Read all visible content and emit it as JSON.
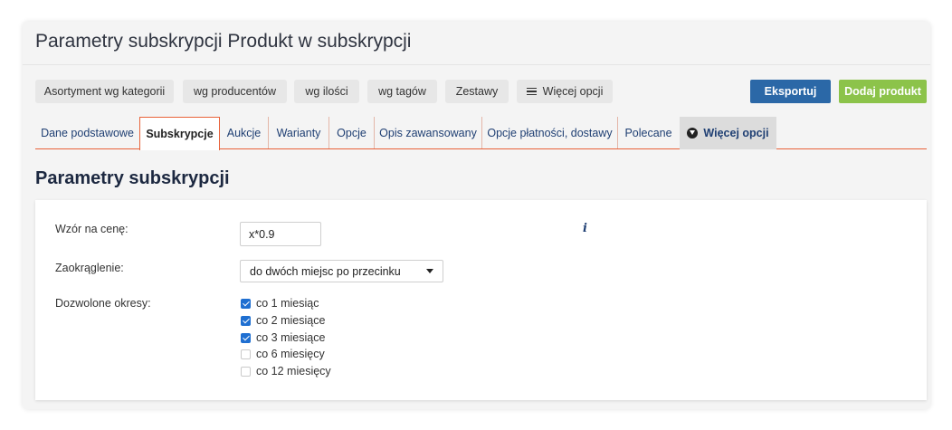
{
  "page": {
    "title": "Parametry subskrypcji Produkt w subskrypcji"
  },
  "filters": [
    {
      "label": "Asortyment wg kategorii"
    },
    {
      "label": "wg producentów"
    },
    {
      "label": "wg ilości"
    },
    {
      "label": "wg tagów"
    },
    {
      "label": "Zestawy"
    },
    {
      "label": "Więcej opcji",
      "icon": "menu-icon"
    }
  ],
  "actions": {
    "export_label": "Eksportuj",
    "export_color": "#2b68a7",
    "add_label": "Dodaj produkt",
    "add_color": "#8cc34a"
  },
  "tabs": [
    {
      "label": "Dane podstawowe"
    },
    {
      "label": "Subskrypcje",
      "active": true
    },
    {
      "label": "Aukcje"
    },
    {
      "label": "Warianty"
    },
    {
      "label": "Opcje"
    },
    {
      "label": "Opis zawansowany"
    },
    {
      "label": "Opcje płatności, dostawy"
    },
    {
      "label": "Polecane"
    },
    {
      "label": "Więcej opcji",
      "icon": "circle-down-icon"
    }
  ],
  "accent_color": "#e8623a",
  "section": {
    "title": "Parametry subskrypcji",
    "price_formula": {
      "label": "Wzór na cenę:",
      "value": "x*0.9"
    },
    "rounding": {
      "label": "Zaokrąglenie:",
      "selected": "do dwóch miejsc po przecinku"
    },
    "periods": {
      "label": "Dozwolone okresy:",
      "options": [
        {
          "label": "co 1 miesiąc",
          "checked": true
        },
        {
          "label": "co 2 miesiące",
          "checked": true
        },
        {
          "label": "co 3 miesiące",
          "checked": true
        },
        {
          "label": "co 6 miesięcy",
          "checked": false
        },
        {
          "label": "co 12 miesięcy",
          "checked": false
        }
      ]
    }
  }
}
